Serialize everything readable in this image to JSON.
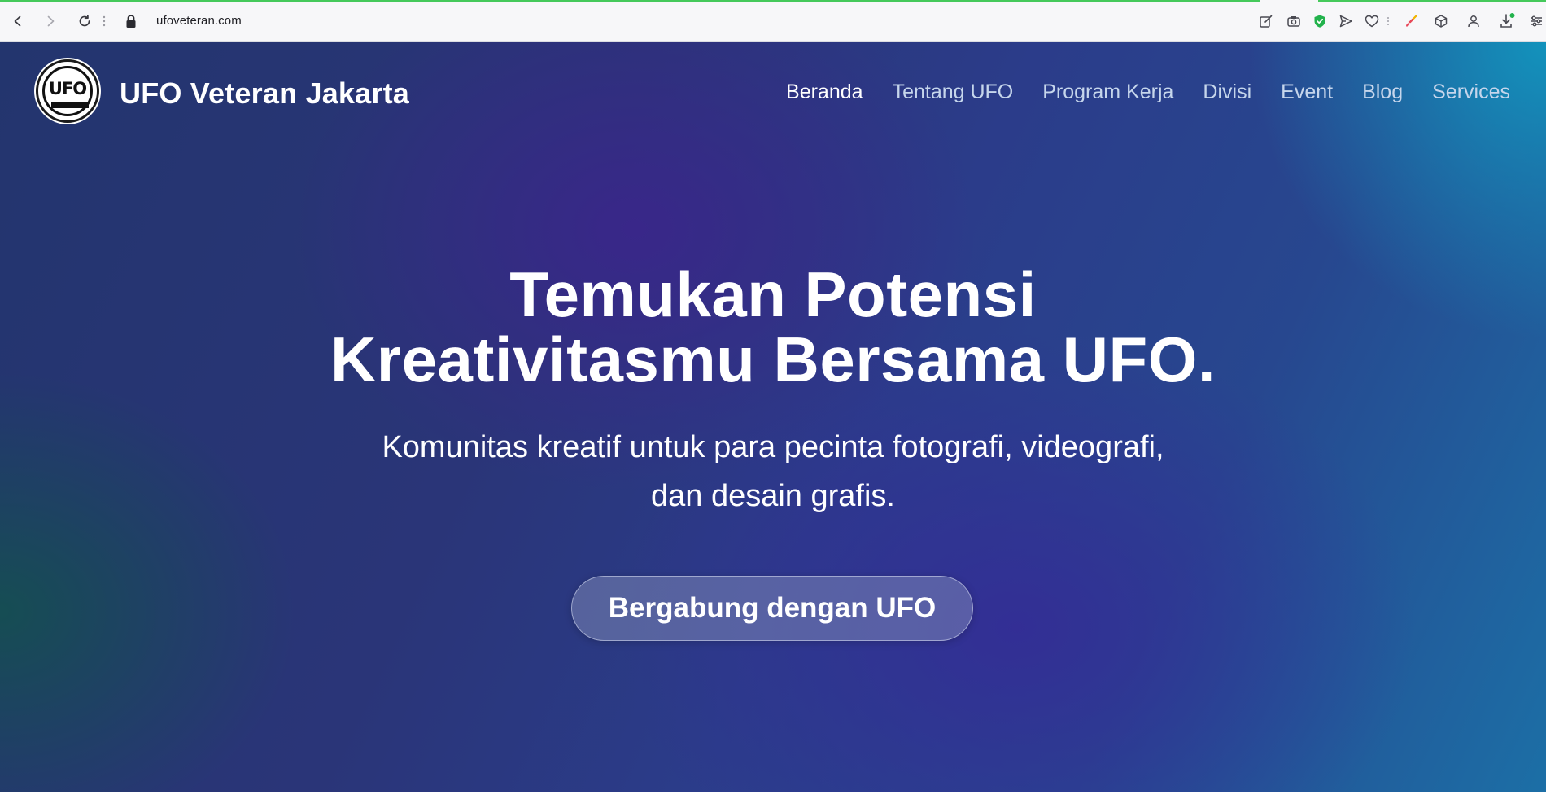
{
  "browser": {
    "url": "ufoveteran.com",
    "icons": [
      "back-icon",
      "forward-icon",
      "reload-icon",
      "lock-icon",
      "edit-icon",
      "camera-icon",
      "shield-icon",
      "send-icon",
      "heart-icon",
      "brush-icon",
      "cube-icon",
      "profile-icon",
      "download-icon",
      "settings-icon"
    ]
  },
  "site": {
    "logo_text": "UFO",
    "name": "UFO Veteran Jakarta"
  },
  "nav": {
    "items": [
      {
        "label": "Beranda",
        "active": true
      },
      {
        "label": "Tentang UFO",
        "active": false
      },
      {
        "label": "Program Kerja",
        "active": false
      },
      {
        "label": "Divisi",
        "active": false
      },
      {
        "label": "Event",
        "active": false
      },
      {
        "label": "Blog",
        "active": false
      },
      {
        "label": "Services",
        "active": false
      }
    ]
  },
  "hero": {
    "headline_line1": "Temukan Potensi",
    "headline_line2": "Kreativitasmu Bersama UFO.",
    "subtext_line1": "Komunitas kreatif untuk para pecinta fotografi, videografi,",
    "subtext_line2": "dan desain grafis.",
    "cta_label": "Bergabung dengan UFO"
  },
  "colors": {
    "accent_green": "#45c95b",
    "nav_inactive": "#c6d6ec",
    "nav_active": "#ffffff"
  }
}
